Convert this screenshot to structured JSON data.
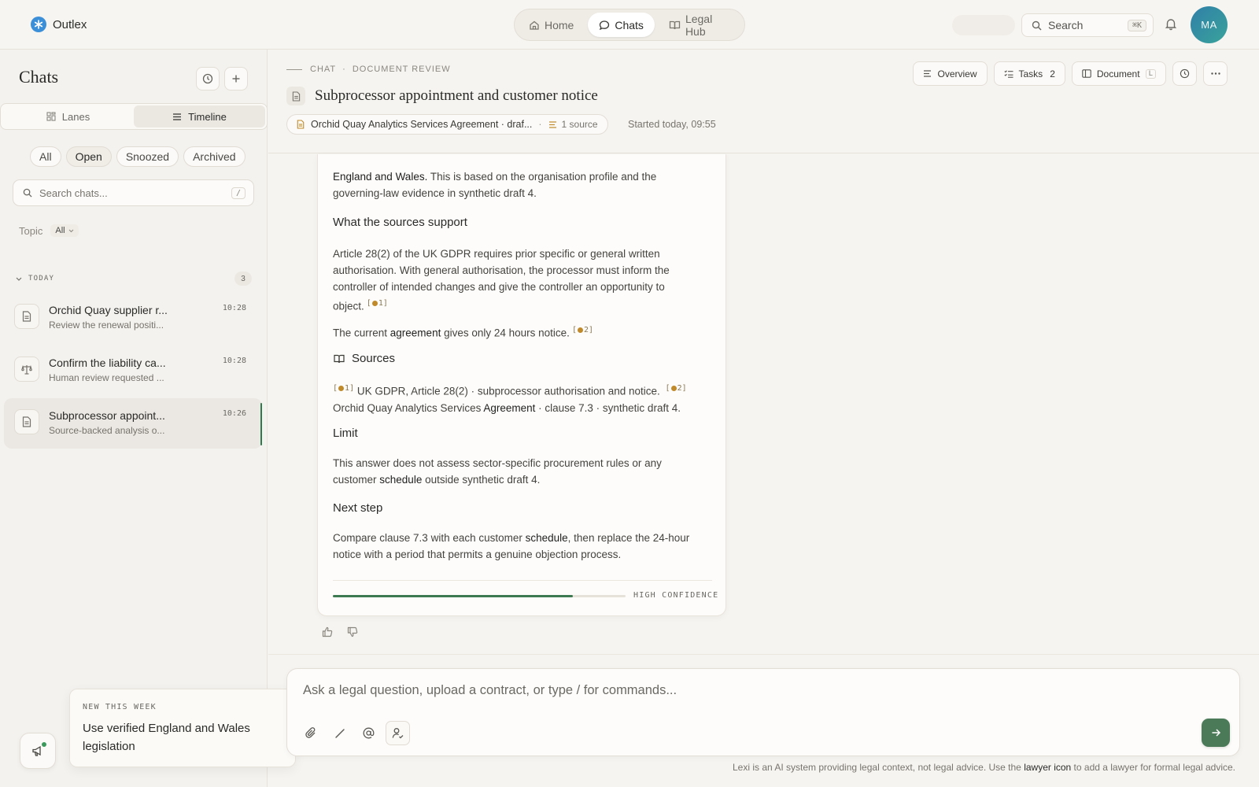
{
  "brand": {
    "name": "Outlex"
  },
  "nav": {
    "home": "Home",
    "chats": "Chats",
    "legal_hub": "Legal Hub"
  },
  "top_search": {
    "label": "Search",
    "shortcut": "⌘K"
  },
  "user": {
    "initials": "MA"
  },
  "sidebar": {
    "title": "Chats",
    "views": {
      "lanes": "Lanes",
      "timeline": "Timeline"
    },
    "filters": [
      "All",
      "Open",
      "Snoozed",
      "Archived"
    ],
    "search": {
      "placeholder": "Search chats...",
      "shortcut": "/"
    },
    "topic": {
      "label": "Topic",
      "value": "All"
    },
    "group": {
      "label": "TODAY",
      "count": "3"
    },
    "items": [
      {
        "title": "Orchid Quay supplier r...",
        "subtitle": "Review the renewal positi...",
        "time": "10:28"
      },
      {
        "title": "Confirm the liability ca...",
        "subtitle": "Human review requested ...",
        "time": "10:28"
      },
      {
        "title": "Subprocessor appoint...",
        "subtitle": "Source-backed analysis o...",
        "time": "10:26"
      }
    ]
  },
  "announcement": {
    "kicker": "NEW THIS WEEK",
    "text": "Use verified England and Wales legislation"
  },
  "chat": {
    "crumb_chat": "CHAT",
    "crumb_sep": "·",
    "crumb_type": "DOCUMENT REVIEW",
    "title": "Subprocessor appointment and customer notice",
    "context_doc": "Orchid Quay Analytics Services Agreement · draf...",
    "context_sep": "·",
    "sources": "1 source",
    "started": "Started today, 09:55",
    "buttons": {
      "overview": "Overview",
      "tasks": "Tasks",
      "tasks_count": "2",
      "document": "Document",
      "document_key": "L"
    }
  },
  "answer": {
    "intro_bold": "England and Wales.",
    "intro_rest": " This is based on the organisation profile and the governing-law evidence in synthetic draft 4.",
    "h_support": "What the sources support",
    "support_p1": "Article 28(2) of the UK GDPR requires prior specific or general written authorisation. With general authorisation, the processor must inform the controller of intended changes and give the controller an opportunity to object.",
    "cite1": "1",
    "support_p2_a": "The current ",
    "support_p2_b": "agreement",
    "support_p2_c": " gives only 24 hours notice.",
    "cite2": "2",
    "h_sources": "Sources",
    "source1": " UK GDPR, Article 28(2) · subprocessor authorisation and notice.",
    "source2_a": "Orchid Quay Analytics Services ",
    "source2_b": "Agreement",
    "source2_c": " · clause 7.3 · synthetic draft 4.",
    "h_limit": "Limit",
    "limit_a": "This answer does not assess sector-specific procurement rules or any customer ",
    "limit_b": "schedule",
    "limit_c": " outside synthetic draft 4.",
    "h_next": "Next step",
    "next_a": "Compare clause 7.3 with each customer ",
    "next_b": "schedule",
    "next_c": ", then replace the 24-hour notice with a period that permits a genuine objection process.",
    "confidence_label": "HIGH CONFIDENCE",
    "confidence_fraction": 0.82
  },
  "composer": {
    "placeholder": "Ask a legal question, upload a contract, or type / for commands..."
  },
  "disclaimer": {
    "before": "Lexi is an AI system providing legal context, not legal advice. Use the ",
    "link": "lawyer icon",
    "after": " to add a lawyer for formal legal advice."
  },
  "colors": {
    "accent": "#4a7a58",
    "brand": "#3b8fd8",
    "citation": "#c08a2a"
  },
  "icons": [
    "asterisk-icon",
    "home-icon",
    "chat-bubble-icon",
    "book-icon",
    "search-icon",
    "bell-icon",
    "history-icon",
    "plus-icon",
    "grid-icon",
    "list-icon",
    "document-icon",
    "scales-icon",
    "megaphone-icon",
    "list-lines-icon",
    "checklist-icon",
    "sidebar-icon",
    "clock-icon",
    "more-icon",
    "thumbs-up-icon",
    "thumbs-down-icon",
    "paperclip-icon",
    "slash-icon",
    "at-icon",
    "user-plus-icon",
    "arrow-right-icon"
  ]
}
